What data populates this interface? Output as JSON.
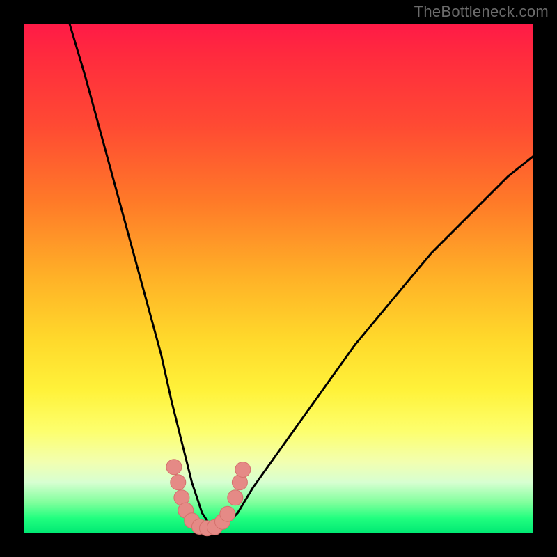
{
  "watermark": "TheBottleneck.com",
  "colors": {
    "frame": "#000000",
    "curve": "#000000",
    "marker_fill": "#e58a86",
    "marker_stroke": "#d4716c",
    "gradient_top": "#ff1a47",
    "gradient_bottom": "#00e873"
  },
  "chart_data": {
    "type": "line",
    "title": "",
    "xlabel": "",
    "ylabel": "",
    "xlim": [
      0,
      100
    ],
    "ylim": [
      0,
      100
    ],
    "grid": false,
    "legend": false,
    "series": [
      {
        "name": "bottleneck-curve",
        "note": "values are vertical extent (0 = bottom / green, 100 = top / red); minimum near x≈36",
        "x": [
          9,
          12,
          15,
          18,
          21,
          24,
          27,
          29,
          31,
          33,
          35,
          37,
          39,
          42,
          45,
          50,
          55,
          60,
          65,
          70,
          75,
          80,
          85,
          90,
          95,
          100
        ],
        "values": [
          100,
          90,
          79,
          68,
          57,
          46,
          35,
          26,
          18,
          10,
          4,
          1,
          1,
          4,
          9,
          16,
          23,
          30,
          37,
          43,
          49,
          55,
          60,
          65,
          70,
          74
        ]
      }
    ],
    "markers": {
      "name": "highlight-dots",
      "note": "salmon dots near the curve minimum; y in same 0–100 scale",
      "points": [
        {
          "x": 29.5,
          "y": 13
        },
        {
          "x": 30.3,
          "y": 10
        },
        {
          "x": 31.0,
          "y": 7
        },
        {
          "x": 31.8,
          "y": 4.5
        },
        {
          "x": 33.0,
          "y": 2.5
        },
        {
          "x": 34.5,
          "y": 1.3
        },
        {
          "x": 36.0,
          "y": 1.0
        },
        {
          "x": 37.5,
          "y": 1.2
        },
        {
          "x": 39.0,
          "y": 2.3
        },
        {
          "x": 40.0,
          "y": 3.8
        },
        {
          "x": 41.5,
          "y": 7.0
        },
        {
          "x": 42.4,
          "y": 10.0
        },
        {
          "x": 43.0,
          "y": 12.5
        }
      ]
    }
  }
}
